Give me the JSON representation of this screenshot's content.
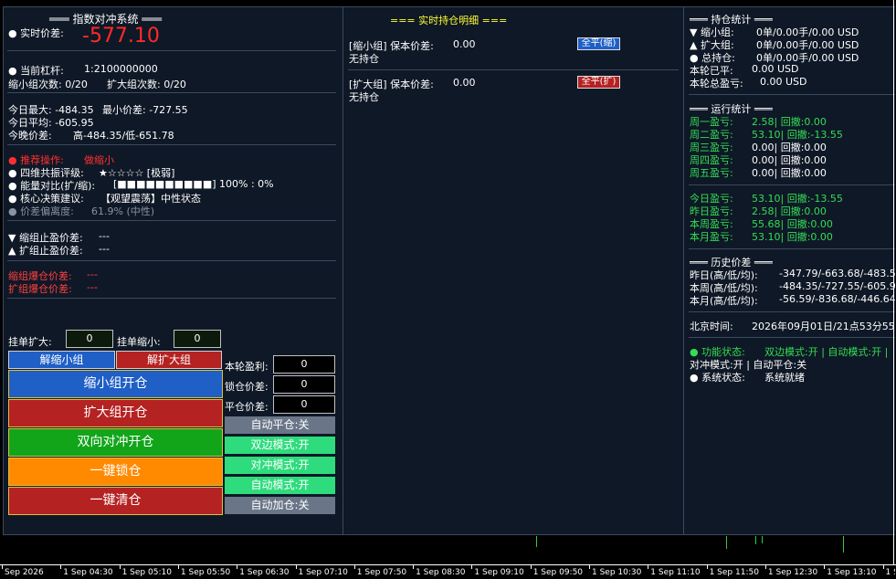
{
  "left": {
    "title": "═══ 指数对冲系统 ═══",
    "price_label": "● 实时价差:",
    "price_value": "-577.10",
    "leverage_label": "● 当前杠杆:",
    "leverage_value": "1:2100000000",
    "shrink_count": "缩小组次数: 0/20",
    "expand_count": "扩大组次数: 0/20",
    "day_max": "今日最大: -484.35",
    "day_min": "最小价差: -727.55",
    "day_avg": "今日平均: -605.95",
    "tonight_label": "今晚价差:",
    "tonight_value": "高-484.35/低-651.78",
    "rec_label": "● 推荐操作:",
    "rec_value": "做缩小",
    "resonance_label": "● 四维共振评级:",
    "resonance_value": "★☆☆☆☆ [极弱]",
    "energy_label": "● 能量对比(扩/缩):",
    "energy_value": "[■■■■■■■■■■] 100% : 0%",
    "decision_label": "● 核心决策建议:",
    "decision_value": "【观望震荡】中性状态",
    "deviation_label": "● 价差偏离度:",
    "deviation_value": "61.9% (中性)",
    "shrink_tp_label": "▼ 缩组止盈价差:",
    "shrink_tp_value": "---",
    "expand_tp_label": "▲ 扩组止盈价差:",
    "expand_tp_value": "---",
    "shrink_liq_label": "缩组爆仓价差:",
    "shrink_liq_value": "---",
    "expand_liq_label": "扩组爆仓价差:",
    "expand_liq_value": "---"
  },
  "controls": {
    "hang_expand_label": "挂单扩大:",
    "hang_expand_value": "0",
    "hang_shrink_label": "挂单缩小:",
    "hang_shrink_value": "0",
    "unlock_shrink": "解缩小组",
    "unlock_expand": "解扩大组",
    "open_shrink": "缩小组开仓",
    "open_expand": "扩大组开仓",
    "open_both": "双向对冲开仓",
    "one_lock": "一键锁仓",
    "one_clear": "一键清仓",
    "round_profit_label": "本轮盈利:",
    "round_profit_value": "0",
    "lock_diff_label": "锁仓价差:",
    "lock_diff_value": "0",
    "close_diff_label": "平仓价差:",
    "close_diff_value": "0",
    "t_auto_close": "自动平仓:关",
    "t_dual": "双边模式:开",
    "t_hedge": "对冲模式:开",
    "t_auto": "自动模式:开",
    "t_auto_add": "自动加仓:关"
  },
  "middle": {
    "title": "=== 实时持仓明细 ===",
    "shrink_line": "[缩小组] 保本价差:",
    "shrink_value": "0.00",
    "shrink_btn": "全平(缩)",
    "shrink_status": "无持仓",
    "expand_line": "[扩大组] 保本价差:",
    "expand_value": "0.00",
    "expand_btn": "全平(扩)",
    "expand_status": "无持仓"
  },
  "right": {
    "pos_title": "═══ 持仓统计 ═══",
    "pos_shrink_label": "▼ 缩小组:",
    "pos_shrink_value": "0单/0.00手/0.00 USD",
    "pos_expand_label": "▲ 扩大组:",
    "pos_expand_value": "0单/0.00手/0.00 USD",
    "pos_total_label": "● 总持仓:",
    "pos_total_value": "0单/0.00手/0.00 USD",
    "round_closed_label": "本轮已平:",
    "round_closed_value": "0.00 USD",
    "round_total_label": "本轮总盈亏:",
    "round_total_value": "0.00 USD",
    "run_title": "═══ 运行统计 ═══",
    "weekdays": [
      {
        "label": "周一盈亏:",
        "value": "2.58| 回撤:0.00",
        "color": "#33dd55"
      },
      {
        "label": "周二盈亏:",
        "value": "53.10| 回撤:-13.55",
        "color": "#33dd55"
      },
      {
        "label": "周三盈亏:",
        "value": "0.00| 回撤:0.00",
        "color": "#ffffff"
      },
      {
        "label": "周四盈亏:",
        "value": "0.00| 回撤:0.00",
        "color": "#ffffff"
      },
      {
        "label": "周五盈亏:",
        "value": "0.00| 回撤:0.00",
        "color": "#ffffff"
      }
    ],
    "periods": [
      {
        "label": "今日盈亏:",
        "value": "53.10| 回撤:-13.55"
      },
      {
        "label": "昨日盈亏:",
        "value": "2.58| 回撤:0.00"
      },
      {
        "label": "本周盈亏:",
        "value": "55.68| 回撤:0.00"
      },
      {
        "label": "本月盈亏:",
        "value": "53.10| 回撤:0.00"
      }
    ],
    "hist_title": "═══ 历史价差 ═══",
    "hist": [
      {
        "label": "昨日(高/低/均):",
        "value": "-347.79/-663.68/-483.54"
      },
      {
        "label": "本周(高/低/均):",
        "value": "-484.35/-727.55/-605.95"
      },
      {
        "label": "本月(高/低/均):",
        "value": "-56.59/-836.68/-446.64"
      }
    ],
    "time_label": "北京时间:",
    "time_value": "2026年09月01日/21点53分55秒",
    "func_label": "● 功能状态:",
    "func_value": "双边模式:开 | 自动模式:开 |",
    "func_line2": "对冲模式:开 | 自动平仓:关",
    "sys_label": "● 系统状态:",
    "sys_value": "系统就绪"
  },
  "axis": [
    "Sep 2026",
    "1 Sep 04:30",
    "1 Sep 05:10",
    "1 Sep 05:50",
    "1 Sep 06:30",
    "1 Sep 07:10",
    "1 Sep 07:50",
    "1 Sep 08:30",
    "1 Sep 09:10",
    "1 Sep 09:50",
    "1 Sep 10:30",
    "1 Sep 11:10",
    "1 Sep 11:50",
    "1 Sep 12:30",
    "1 Sep 13:10",
    "1 Sep"
  ],
  "colors": {
    "blue_btn": "#1f5fc6",
    "red_btn": "#b52222",
    "green_btn": "#12a51a",
    "orange_btn": "#ff8a00",
    "toggle_on": "#2edc7d",
    "toggle_off": "#6a7688"
  }
}
